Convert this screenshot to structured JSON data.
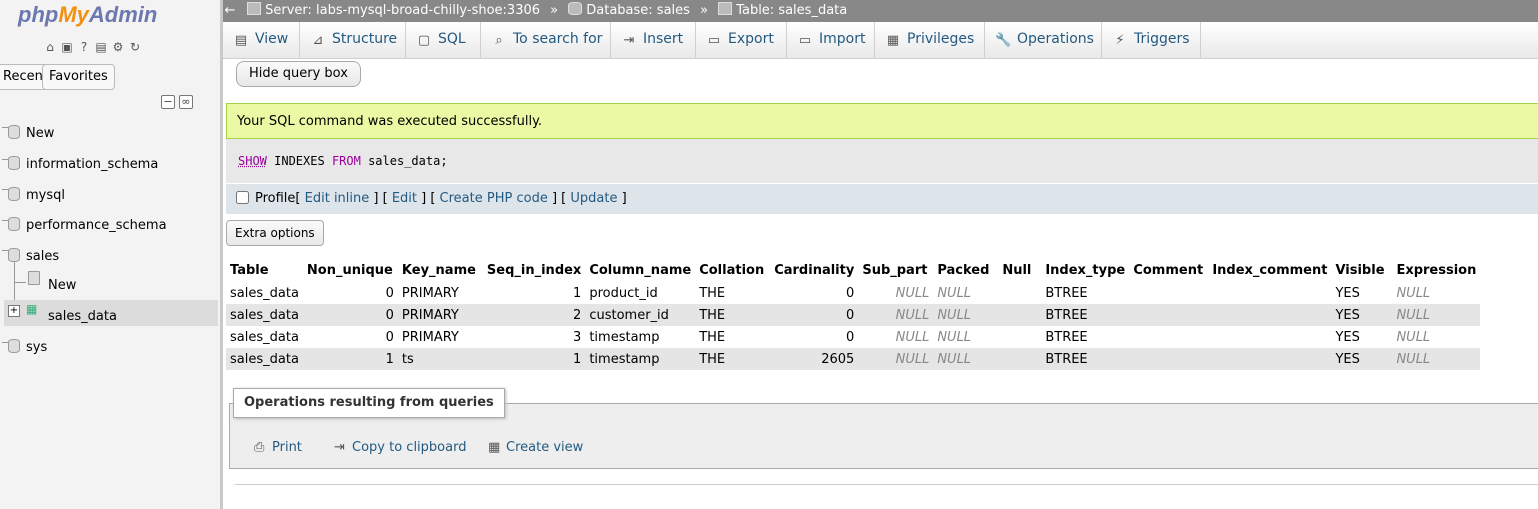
{
  "nav": {
    "logo": {
      "php": "php",
      "my": "My",
      "admin": "Admin"
    },
    "icons": [
      "home-icon",
      "exit-icon",
      "help-icon",
      "docs-icon",
      "settings-icon",
      "reload-icon"
    ],
    "tabs": {
      "recent": "Recent",
      "favorites": "Favorites"
    },
    "tree": {
      "new_db": "New",
      "databases": [
        "information_schema",
        "mysql",
        "performance_schema",
        "sales"
      ],
      "sales_new": "New",
      "sales_table": "sales_data",
      "sys": "sys"
    }
  },
  "breadcrumb": {
    "server": "Server: labs-mysql-broad-chilly-shoe:3306",
    "database": "Database: sales",
    "table": "Table: sales_data",
    "separator": "»"
  },
  "menu": {
    "view": "View",
    "structure": "Structure",
    "sql": "SQL",
    "search": "To search for",
    "insert": "Insert",
    "export": "Export",
    "import": "Import",
    "privileges": "Privileges",
    "operations": "Operations",
    "triggers": "Triggers"
  },
  "main": {
    "hide_query_box": "Hide query box",
    "success_message": "Your SQL command was executed successfully.",
    "sql": {
      "kw1": "SHOW",
      "mid": " INDEXES ",
      "kw2": "FROM",
      "rest": " sales_data;"
    },
    "profile": {
      "label": "Profile",
      "edit_inline": "Edit inline",
      "edit": "Edit",
      "create_php": "Create PHP code",
      "update": "Update"
    },
    "extra_options": "Extra options",
    "columns": [
      "Table",
      "Non_unique",
      "Key_name",
      "Seq_in_index",
      "Column_name",
      "Collation",
      "Cardinality",
      "Sub_part",
      "Packed",
      "Null",
      "Index_type",
      "Comment",
      "Index_comment",
      "Visible",
      "Expression"
    ],
    "rows": [
      [
        "sales_data",
        "0",
        "PRIMARY",
        "1",
        "product_id",
        "THE",
        "0",
        "NULL",
        "NULL",
        "",
        "BTREE",
        "",
        "",
        "YES",
        "NULL"
      ],
      [
        "sales_data",
        "0",
        "PRIMARY",
        "2",
        "customer_id",
        "THE",
        "0",
        "NULL",
        "NULL",
        "",
        "BTREE",
        "",
        "",
        "YES",
        "NULL"
      ],
      [
        "sales_data",
        "0",
        "PRIMARY",
        "3",
        "timestamp",
        "THE",
        "0",
        "NULL",
        "NULL",
        "",
        "BTREE",
        "",
        "",
        "YES",
        "NULL"
      ],
      [
        "sales_data",
        "1",
        "ts",
        "1",
        "timestamp",
        "THE",
        "2605",
        "NULL",
        "NULL",
        "",
        "BTREE",
        "",
        "",
        "YES",
        "NULL"
      ]
    ],
    "operations": {
      "legend": "Operations resulting from queries",
      "print": "Print",
      "copy": "Copy to clipboard",
      "create_view": "Create view"
    }
  }
}
